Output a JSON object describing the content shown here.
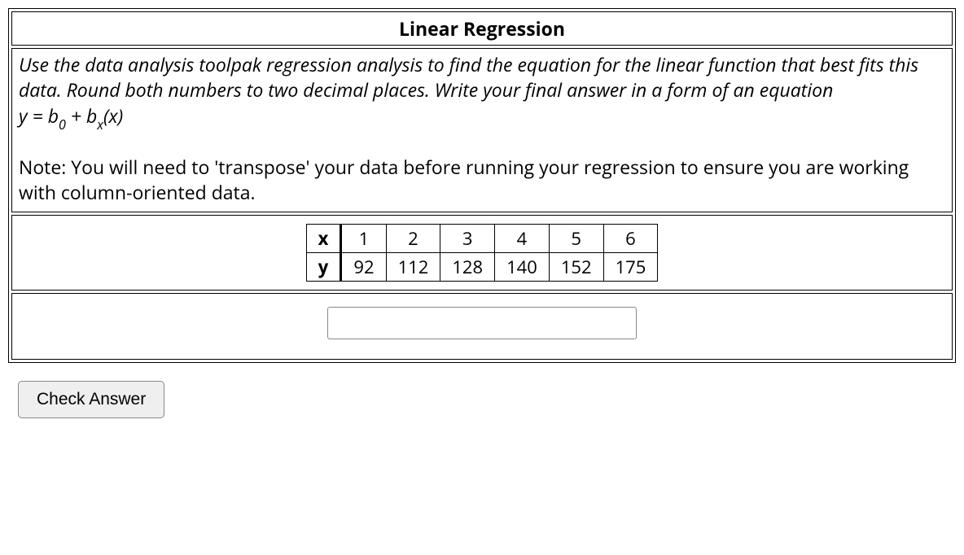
{
  "title": "Linear Regression",
  "instructions": "Use the data analysis toolpak regression analysis to find the equation for the linear function that best fits this data. Round both numbers to two decimal places. Write your final answer in a form of an equation",
  "equation": {
    "prefix": "y = b",
    "sub1": "0",
    "mid": " + b",
    "sub2": "x",
    "suffix": "(x)"
  },
  "note": "Note: You will need to 'transpose' your data before running your regression to ensure you are working with column-oriented data.",
  "table": {
    "rows": [
      {
        "label": "x",
        "values": [
          "1",
          "2",
          "3",
          "4",
          "5",
          "6"
        ]
      },
      {
        "label": "y",
        "values": [
          "92",
          "112",
          "128",
          "140",
          "152",
          "175"
        ]
      }
    ]
  },
  "answer_value": "",
  "check_button": "Check Answer"
}
